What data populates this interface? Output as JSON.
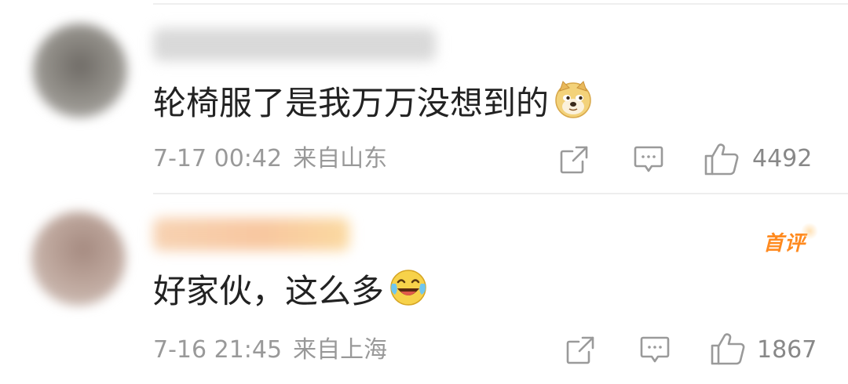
{
  "comments": [
    {
      "author_name": "",
      "text": "轮椅服了是我万万没想到的",
      "emoji": "doge-emoji",
      "date": "7-17 00:42",
      "location": "来自山东",
      "likes": "4492",
      "badge": "",
      "avatar_color": "#8a8a88",
      "name_color": "#d9d9d9"
    },
    {
      "author_name": "",
      "text": "好家伙，这么多",
      "emoji": "laughing-crying-emoji",
      "date": "7-16 21:45",
      "location": "来自上海",
      "likes": "1867",
      "badge": "首评",
      "avatar_color": "#b49a90",
      "name_color": "#f6c9a0"
    }
  ],
  "colors": {
    "text": "#222222",
    "meta": "#999999",
    "icon": "#9a9a9a",
    "badge": "#ff8a1f",
    "divider": "#eeeeee"
  },
  "icons": {
    "share": "share-icon",
    "comment": "comment-icon",
    "like": "thumbs-up-icon"
  }
}
